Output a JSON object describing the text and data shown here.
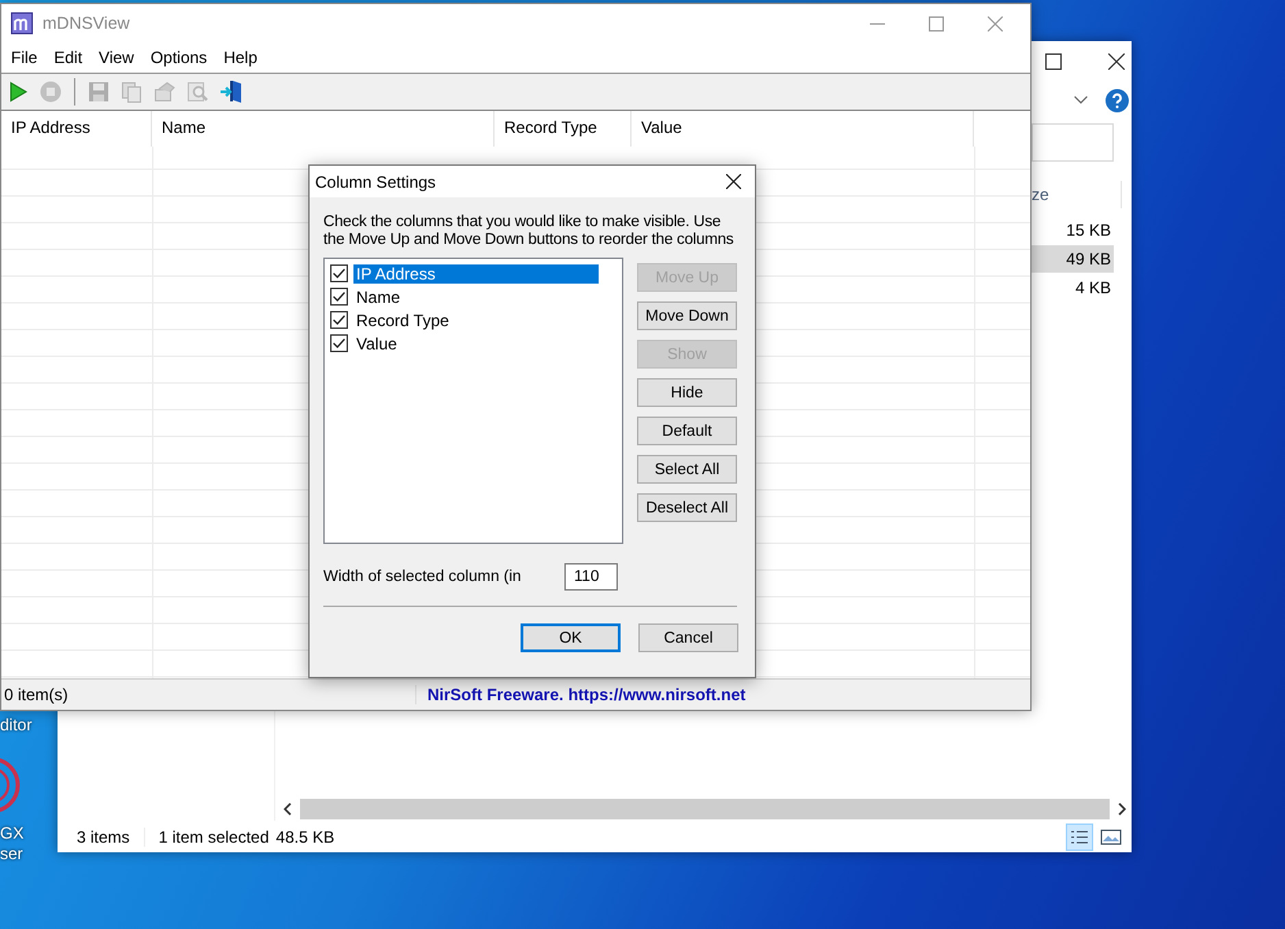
{
  "desktop_icons": [
    {
      "kind": "label_only",
      "lines": [
        "ditor"
      ]
    },
    {
      "kind": "red_ring",
      "lines": [
        "GX",
        "ser"
      ]
    }
  ],
  "explorer": {
    "column_header": "ze",
    "rows": [
      {
        "size": "15 KB",
        "selected": false
      },
      {
        "size": "49 KB",
        "selected": true
      },
      {
        "size": "4 KB",
        "selected": false
      }
    ],
    "status": [
      "3 items",
      "1 item selected",
      "48.5 KB"
    ],
    "view_buttons": [
      {
        "kind": "details",
        "selected": true
      },
      {
        "kind": "preview",
        "selected": false
      }
    ]
  },
  "app": {
    "title": "mDNSView",
    "menu": [
      "File",
      "Edit",
      "View",
      "Options",
      "Help"
    ],
    "toolbar": [
      {
        "kind": "play",
        "disabled": false
      },
      {
        "kind": "stop",
        "disabled": true
      },
      {
        "kind": "separator"
      },
      {
        "kind": "save",
        "disabled": true
      },
      {
        "kind": "copy",
        "disabled": true
      },
      {
        "kind": "properties",
        "disabled": true
      },
      {
        "kind": "find",
        "disabled": true
      },
      {
        "kind": "exit",
        "disabled": false
      }
    ],
    "columns": [
      "IP Address",
      "Name",
      "Record Type",
      "Value"
    ],
    "status": "0 item(s)",
    "credit": "NirSoft Freeware. https://www.nirsoft.net"
  },
  "dialog": {
    "title": "Column Settings",
    "instructions": "Check the columns that you would like to make visible. Use the Move Up and Move Down buttons to reorder the columns",
    "items": [
      {
        "label": "IP Address",
        "checked": true,
        "selected": true
      },
      {
        "label": "Name",
        "checked": true,
        "selected": false
      },
      {
        "label": "Record Type",
        "checked": true,
        "selected": false
      },
      {
        "label": "Value",
        "checked": true,
        "selected": false
      }
    ],
    "buttons": [
      {
        "label": "Move Up",
        "disabled": true
      },
      {
        "label": "Move Down",
        "disabled": false
      },
      {
        "label": "Show",
        "disabled": true
      },
      {
        "label": "Hide",
        "disabled": false
      },
      {
        "label": "Default",
        "disabled": false
      },
      {
        "label": "Select All",
        "disabled": false
      },
      {
        "label": "Deselect All",
        "disabled": false
      }
    ],
    "width_label": "Width of selected column (in",
    "width_value": "110",
    "ok": "OK",
    "cancel": "Cancel"
  }
}
